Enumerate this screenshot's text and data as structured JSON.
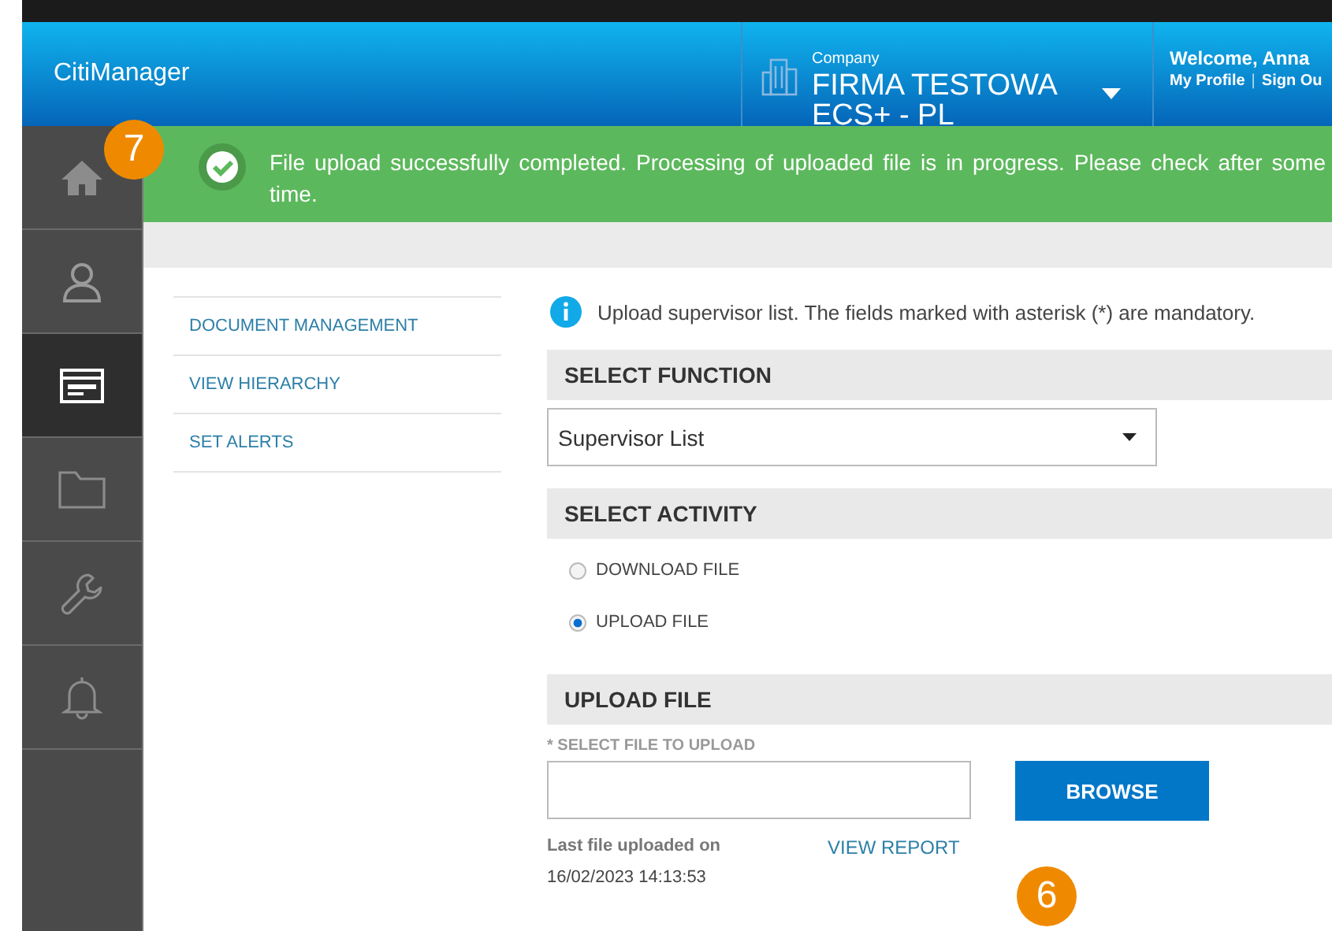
{
  "header": {
    "brand": "CitiManager",
    "company_label": "Company",
    "company_name": "FIRMA TESTOWA ECS+ - PL",
    "welcome": "Welcome, Anna",
    "links": [
      "My Profile",
      "Sign Ou"
    ],
    "link_separator": "|"
  },
  "sidebar": {
    "items": [
      {
        "kind": "home",
        "selected": false
      },
      {
        "kind": "user",
        "selected": false
      },
      {
        "kind": "document",
        "selected": true
      },
      {
        "kind": "folder",
        "selected": false
      },
      {
        "kind": "wrench",
        "selected": false
      },
      {
        "kind": "bell",
        "selected": false
      }
    ]
  },
  "notification": {
    "message": "File upload successfully completed. Processing of uploaded file is in progress. Please check after some time."
  },
  "callouts": [
    "7",
    "6"
  ],
  "nav": {
    "items": [
      {
        "label": "DOCUMENT MANAGEMENT",
        "selected": false
      },
      {
        "label": "VIEW HIERARCHY",
        "selected": false
      },
      {
        "label": "SET ALERTS",
        "selected": false
      }
    ]
  },
  "info": "Upload supervisor list. The fields marked with asterisk (*) are mandatory.",
  "function_section": {
    "title": "SELECT FUNCTION",
    "value": "Supervisor List"
  },
  "activity_section": {
    "title": "SELECT ACTIVITY",
    "options": [
      {
        "label": "DOWNLOAD FILE",
        "selected": false
      },
      {
        "label": "UPLOAD FILE",
        "selected": true
      }
    ]
  },
  "upload_section": {
    "title": "UPLOAD FILE",
    "field_label": "* SELECT FILE TO UPLOAD",
    "browse": "BROWSE",
    "last_label": "Last file uploaded on",
    "last_date": "16/02/2023 14:13:53",
    "report_link": "VIEW REPORT"
  }
}
